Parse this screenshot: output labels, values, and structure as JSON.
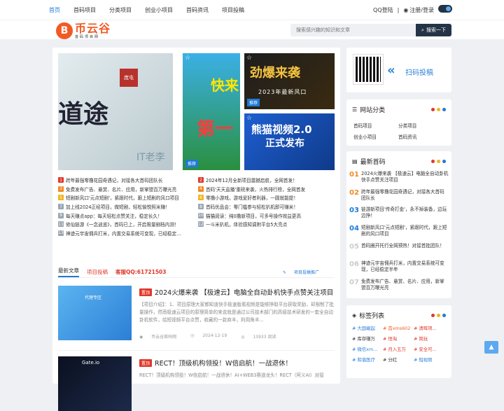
{
  "topnav": {
    "items": [
      "首页",
      "首码项目",
      "分类项目",
      "创业小项目",
      "首码资讯",
      "项目投稿"
    ],
    "active": 0,
    "qq_login": "QQ登陆",
    "register_login": "注册/登录",
    "separator": "|"
  },
  "header": {
    "logo_letter": "B",
    "logo_name": "币云谷",
    "logo_sub": "首码项目网",
    "search_placeholder": "搜索感兴趣的知识和文章",
    "search_button": "搜索一下"
  },
  "slides": {
    "big": {
      "title": "道途",
      "seal": "庞屯",
      "watermark": "IT老李"
    },
    "mid": {
      "t1": "快来",
      "t2": "第一",
      "tag": "推荐"
    },
    "r1": {
      "t1": "劲爆来袭",
      "t2": "2023年最新风口",
      "tag": "推荐"
    },
    "r2": {
      "t1": "熊猫视频2.0",
      "t2": "正式发布"
    }
  },
  "news": [
    {
      "n": "1",
      "text": "跨年最强零撸花园奇遇记，对接各大首码团队长",
      "n2": "2",
      "text2": "2024年12月全新项目震撼启航，全网首发！"
    },
    {
      "n": "3",
      "text": "免费发布广告、悬赏、名片、应用，新掌盟百万曝光亮",
      "n2": "4",
      "text2": "首码'天天直播'重磅来袭，火热排行榜，全网首发"
    },
    {
      "n": "5",
      "text": "短剧新风口'元点短剧'，紧跟时代，跟上短剧的风口项目",
      "n2": "6",
      "text2": "零撸小游戏，游戏爱好者利器，一圆就能提！"
    },
    {
      "n": "7",
      "text": "加上线2024正经项目，做短剧，轻松愉悦照米赚！",
      "n2": "8",
      "text2": "首码优品会：零门槛参与轻松扒机即可赚米！"
    },
    {
      "n": "9",
      "text": "每天赚点app：每天轻松点赞关注，稳定长久！",
      "n2": "10",
      "text2": "猫猫阅读：纯0撸新项目，可多号操作效益更高"
    },
    {
      "n": "11",
      "text": "修仙链游《一念逍遥》，首码已上，开启限量剧档内测！",
      "n2": "12",
      "text2": "一斗米扒机，体验感知调附平台5大亮点"
    },
    {
      "n": "13",
      "text": "神迹元宇宙佣兵打米，内置交易系统可变现，已经稳定...",
      "n2": "",
      "text2": ""
    }
  ],
  "tabs": {
    "items": [
      "最新文章",
      "项目投稿",
      "客服QQ:61721503"
    ],
    "more": "项目投稿推广"
  },
  "articles": [
    {
      "badge": "置顶",
      "title": "2024火爆来袭 【极速云】电脑全自动卦机快手点赞关注项目",
      "summary": "【项目介绍】：1、项目原理大家都知道快手极速版看视频是能够挣取平台获取奖励，却限制了批量操作，然而极速云项目的原理简单的来说就是通过公司技术部门的高级技术研发的一套全自动卦机软件，给短视频平台点赞，收藏的一款商丰，利用角丰...",
      "author": "币云谷首码网",
      "date": "2024-12-19",
      "views": "13933 阅读",
      "thumb_text": "代理专区"
    },
    {
      "badge": "置顶",
      "title": "RECT！顶级机构领投！W倍启航！一战退休！",
      "summary": "RECT！顶级机构领投！W倍启航！一战退休！AI+WEB3赛道龙头！RECT（阿义AI）对接",
      "thumb_text": "Gate.io"
    }
  ],
  "sidebar": {
    "scan": {
      "text": "扫码投稿"
    },
    "categories": {
      "title": "网站分类",
      "items": [
        "首码项目",
        "分类项目",
        "创业小项目",
        "首码资讯"
      ]
    },
    "recent": {
      "title": "最新首码",
      "items": [
        {
          "n": "01",
          "text": "2024火爆来袭 【极速云】电脑全自动卦机快手点赞关注项目"
        },
        {
          "n": "02",
          "text": "跨年最强零撸花园奇遇记，对接各大首码团队长"
        },
        {
          "n": "03",
          "text": "链游新项目'传奇打金'，永不掉装备，边玩边挣！"
        },
        {
          "n": "04",
          "text": "短剧新风口'元点短剧'，紧跟时代，跟上短剧的风口项目"
        },
        {
          "n": "05",
          "text": "首码圈开托行全网预热！对接首批团队！"
        },
        {
          "n": "06",
          "text": "神迹元宇宙佣兵打米，内置交易系统可变现，已经稳定半年"
        },
        {
          "n": "07",
          "text": "免费发布广告、悬赏、名片、应用，新掌盟百万曝光亮"
        }
      ]
    },
    "tags": {
      "title": "标签列表",
      "items": [
        {
          "t": "# 大国崛起",
          "c": "#2b7fd6"
        },
        {
          "t": "# 首xms602",
          "c": "#f15a24"
        },
        {
          "t": "# 清晖项...",
          "c": "#e0382a"
        },
        {
          "t": "# 库存赚万",
          "c": "#333333"
        },
        {
          "t": "# 悟淘",
          "c": "#e0382a"
        },
        {
          "t": "# 简玩",
          "c": "#e0382a"
        },
        {
          "t": "# 微信xm...",
          "c": "#2b7fd6"
        },
        {
          "t": "# 月入五万",
          "c": "#e0382a"
        },
        {
          "t": "# 安全可...",
          "c": "#e0382a"
        },
        {
          "t": "# 和谐医疗",
          "c": "#2b7fd6"
        },
        {
          "t": "# 分红",
          "c": "#333333"
        },
        {
          "t": "# 短视频",
          "c": "#2b7fd6"
        }
      ]
    }
  },
  "colors": {
    "accent": "#1e7ad6",
    "brand": "#f15a24",
    "dark": "#243447",
    "red": "#e0382a"
  },
  "num_colors": [
    "#e0382a",
    "#f08a24",
    "#f3b41c",
    "#9aa5b1"
  ]
}
